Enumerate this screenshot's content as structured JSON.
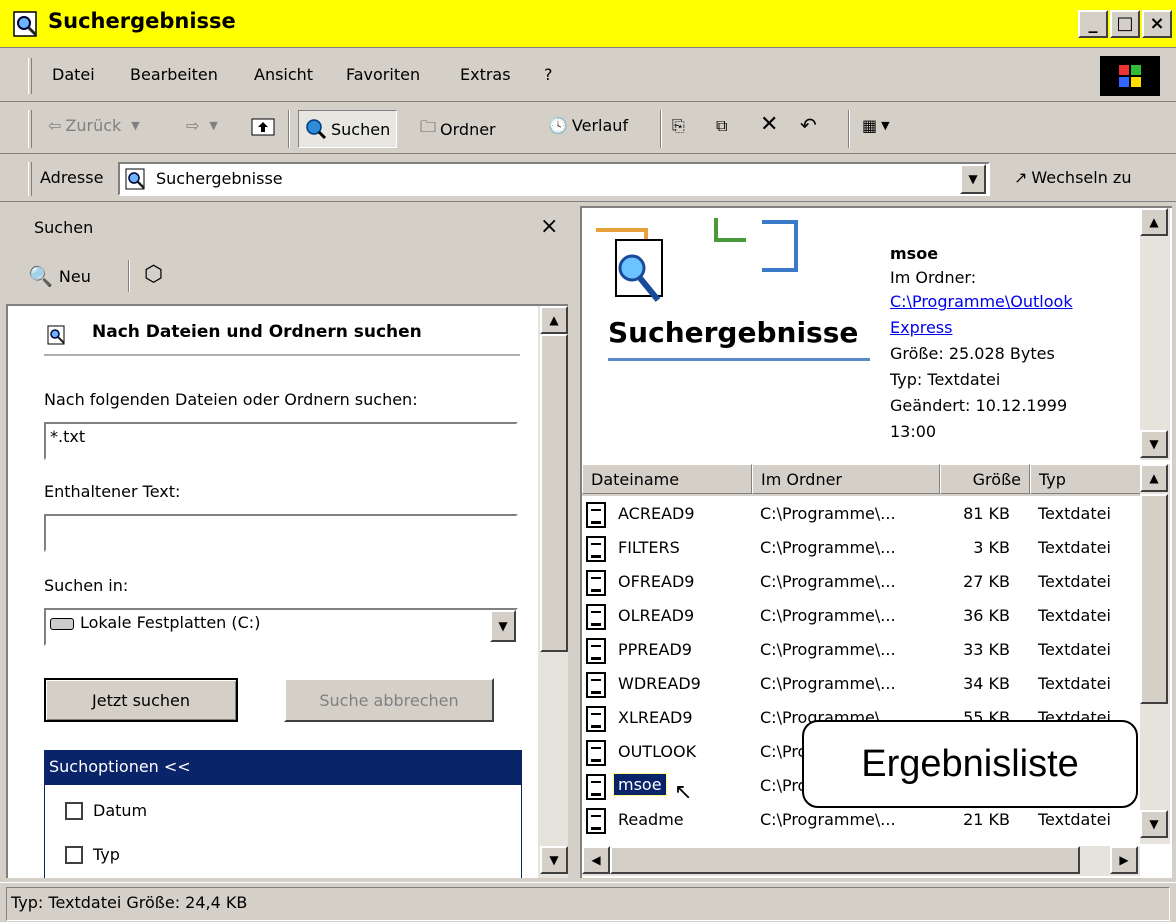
{
  "window": {
    "title": "Suchergebnisse",
    "controls": {
      "minimize": "_",
      "maximize": "□",
      "close": "×"
    }
  },
  "menubar": {
    "items": [
      "Datei",
      "Bearbeiten",
      "Ansicht",
      "Favoriten",
      "Extras",
      "?"
    ]
  },
  "toolbar": {
    "back": "Zurück",
    "search": "Suchen",
    "folders": "Ordner",
    "history": "Verlauf"
  },
  "address": {
    "label": "Adresse",
    "value": "Suchergebnisse",
    "go": "Wechseln zu"
  },
  "search_panel": {
    "title": "Suchen",
    "close": "×",
    "new_label": "Neu",
    "heading": "Nach Dateien und Ordnern suchen",
    "files_label": "Nach folgenden Dateien oder Ordnern suchen:",
    "files_value": "*.txt",
    "text_label": "Enthaltener Text:",
    "text_value": "",
    "lookin_label": "Suchen in:",
    "lookin_value": "Lokale Festplatten (C:)",
    "search_button": "Jetzt suchen",
    "stop_button": "Suche abbrechen",
    "options_header": "Suchoptionen <<",
    "options": [
      {
        "label": "Datum",
        "checked": false
      },
      {
        "label": "Typ",
        "checked": false
      }
    ]
  },
  "details": {
    "banner": "Suchergebnisse",
    "name": "msoe",
    "folder_label": "Im Ordner:",
    "folder_link_1": "C:\\Programme\\Outlook",
    "folder_link_2": "Express",
    "size": "Größe: 25.028 Bytes",
    "type": "Typ: Textdatei",
    "modified": "Geändert: 10.12.1999",
    "modified_time": "13:00"
  },
  "results": {
    "columns": [
      "Dateiname",
      "Im Ordner",
      "Größe",
      "Typ"
    ],
    "rows": [
      {
        "name": "ACREAD9",
        "folder": "C:\\Programme\\...",
        "size": "81 KB",
        "type": "Textdatei"
      },
      {
        "name": "FILTERS",
        "folder": "C:\\Programme\\...",
        "size": "3 KB",
        "type": "Textdatei"
      },
      {
        "name": "OFREAD9",
        "folder": "C:\\Programme\\...",
        "size": "27 KB",
        "type": "Textdatei"
      },
      {
        "name": "OLREAD9",
        "folder": "C:\\Programme\\...",
        "size": "36 KB",
        "type": "Textdatei"
      },
      {
        "name": "PPREAD9",
        "folder": "C:\\Programme\\...",
        "size": "33 KB",
        "type": "Textdatei"
      },
      {
        "name": "WDREAD9",
        "folder": "C:\\Programme\\...",
        "size": "34 KB",
        "type": "Textdatei"
      },
      {
        "name": "XLREAD9",
        "folder": "C:\\Programme\\...",
        "size": "55 KB",
        "type": "Textdatei"
      },
      {
        "name": "OUTLOOK",
        "folder": "C:\\Programme\\...",
        "size": "",
        "type": ""
      },
      {
        "name": "msoe",
        "folder": "C:\\Programme\\...",
        "size": "",
        "type": "",
        "selected": true
      },
      {
        "name": "Readme",
        "folder": "C:\\Programme\\...",
        "size": "21 KB",
        "type": "Textdatei"
      }
    ]
  },
  "callout": {
    "text": "Ergebnisliste"
  },
  "status": {
    "text": "Typ: Textdatei Größe: 24,4 KB"
  },
  "colors": {
    "title_bar": "#ffff00",
    "chrome": "#d4d0c8",
    "selection": "#0a246a",
    "link": "#0000ee"
  }
}
